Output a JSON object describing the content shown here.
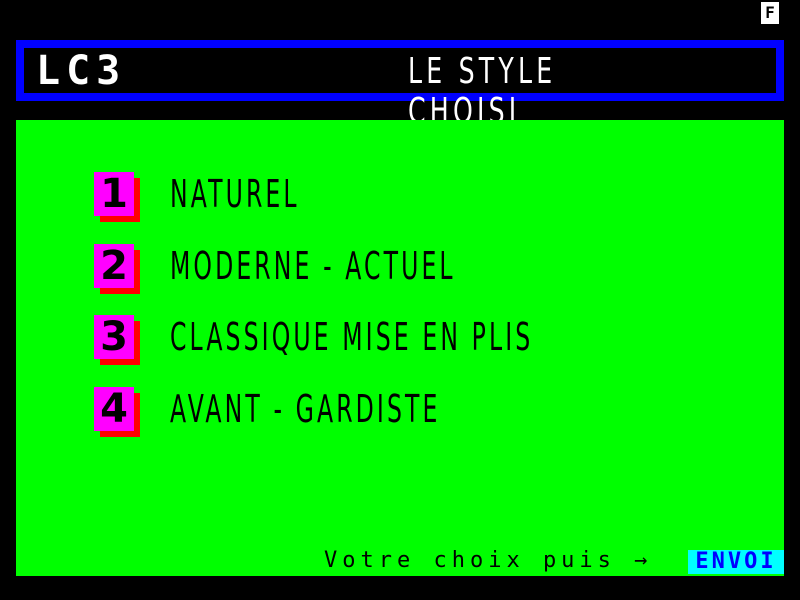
{
  "status": {
    "indicator": "F"
  },
  "header": {
    "code": "LC3",
    "title": "LE STYLE CHOISI"
  },
  "menu": {
    "items": [
      {
        "number": "1",
        "label": "NATUREL"
      },
      {
        "number": "2",
        "label": "MODERNE - ACTUEL"
      },
      {
        "number": "3",
        "label": "CLASSIQUE MISE EN PLIS"
      },
      {
        "number": "4",
        "label": "AVANT - GARDISTE"
      }
    ]
  },
  "footer": {
    "prompt": "Votre choix puis →",
    "send_label": "ENVOI"
  },
  "colors": {
    "background": "#000000",
    "header_border": "#0000ff",
    "panel": "#00ff00",
    "number_box": "#ff00ff",
    "number_shadow": "#ff0000",
    "send_key": "#00ffff"
  }
}
